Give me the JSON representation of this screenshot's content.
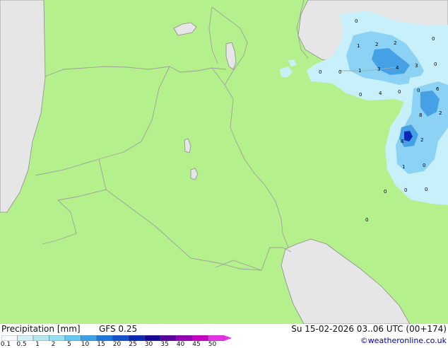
{
  "legend": {
    "title": "Precipitation [mm]",
    "model": "GFS 0.25",
    "datetime": "Su 15-02-2026 03..06 UTC (00+174)",
    "credit": "©weatheronline.co.uk",
    "ticks": [
      "0.1",
      "0.5",
      "1",
      "2",
      "5",
      "10",
      "15",
      "20",
      "25",
      "30",
      "35",
      "40",
      "45",
      "50"
    ],
    "colors": [
      "#f5fbff",
      "#d2f0f6",
      "#b4e6f0",
      "#96dcf0",
      "#64c8f0",
      "#3ca0e6",
      "#1e78dc",
      "#1450c8",
      "#0a28b4",
      "#140a96",
      "#5a00a0",
      "#9600b4",
      "#c800c8",
      "#e632e6"
    ]
  },
  "colors": {
    "land": "#b4f08c",
    "sea": "#e6e6e6",
    "border": "#a0a0a0",
    "precip_light": "#c8f0fa",
    "precip_medium": "#8cd2f5",
    "precip_heavy": "#46a0e6",
    "precip_core": "#0a28b4"
  },
  "precip_labels": [
    "0",
    "1",
    "2",
    "2",
    "0",
    "0",
    "0",
    "1",
    "3",
    "4",
    "3",
    "0",
    "0",
    "4",
    "0",
    "0",
    "6",
    "8",
    "2",
    "8",
    "2",
    "1",
    "0",
    "0",
    "0",
    "0",
    "0"
  ]
}
